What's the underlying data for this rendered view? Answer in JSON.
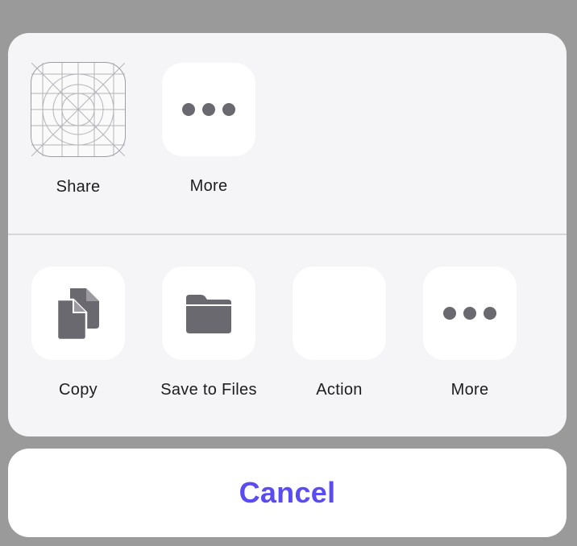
{
  "share_sheet": {
    "apps": [
      {
        "label": "Share",
        "icon": "app-icon-grid-template"
      },
      {
        "label": "More",
        "icon": "more-dots-icon"
      }
    ],
    "actions": [
      {
        "label": "Copy",
        "icon": "copy-icon"
      },
      {
        "label": "Save to Files",
        "icon": "folder-icon"
      },
      {
        "label": "Action",
        "icon": ""
      },
      {
        "label": "More",
        "icon": "more-dots-icon"
      }
    ]
  },
  "cancel": {
    "label": "Cancel"
  },
  "colors": {
    "overlay": "#9a9a9a",
    "sheet": "#f5f5f7",
    "tile": "#ffffff",
    "icon_glyph": "#6b6970",
    "cancel_text": "#5a4bf2"
  }
}
